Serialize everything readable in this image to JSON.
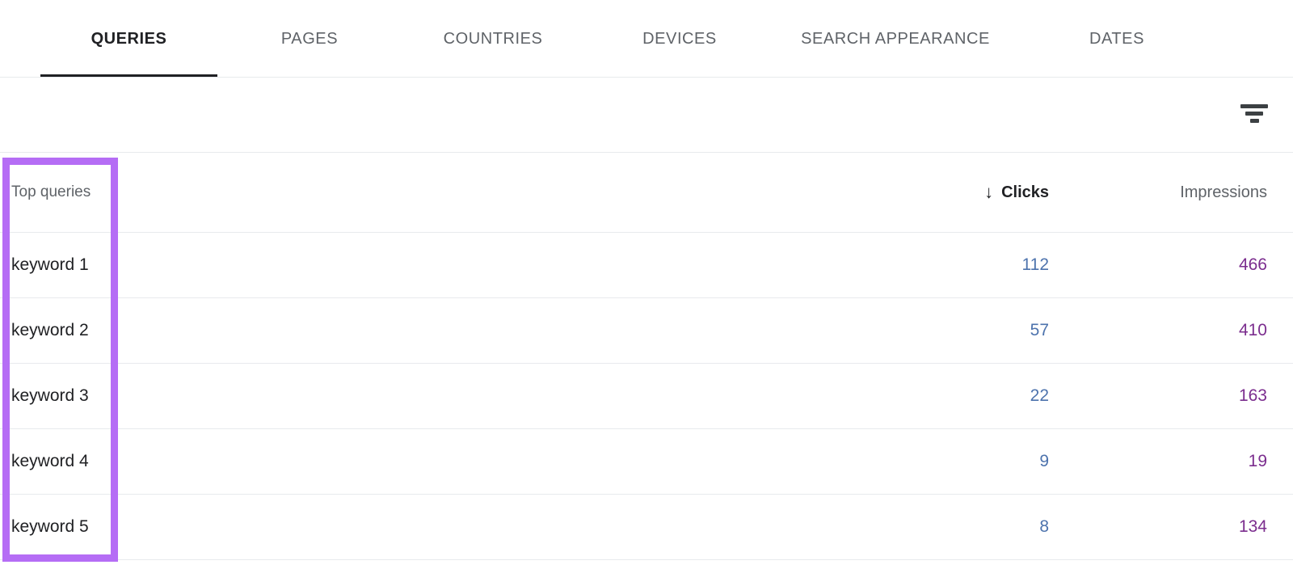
{
  "tabs": [
    {
      "label": "QUERIES",
      "active": true
    },
    {
      "label": "PAGES",
      "active": false
    },
    {
      "label": "COUNTRIES",
      "active": false
    },
    {
      "label": "DEVICES",
      "active": false
    },
    {
      "label": "SEARCH APPEARANCE",
      "active": false
    },
    {
      "label": "DATES",
      "active": false
    }
  ],
  "toolbar": {
    "filter_icon": "filter-icon"
  },
  "table": {
    "columns": {
      "query": "Top queries",
      "clicks": "Clicks",
      "impressions": "Impressions"
    },
    "sort": {
      "column": "Clicks",
      "direction": "descending",
      "arrow_glyph": "↓"
    },
    "rows": [
      {
        "query": "keyword 1",
        "clicks": "112",
        "impressions": "466"
      },
      {
        "query": "keyword 2",
        "clicks": "57",
        "impressions": "410"
      },
      {
        "query": "keyword 3",
        "clicks": "22",
        "impressions": "163"
      },
      {
        "query": "keyword 4",
        "clicks": "9",
        "impressions": "19"
      },
      {
        "query": "keyword 5",
        "clicks": "8",
        "impressions": "134"
      }
    ]
  },
  "annotation": {
    "highlight_color": "#b56df5",
    "target": "Top queries column"
  },
  "colors": {
    "clicks_value": "#4d73ad",
    "impressions_value": "#7b2d8e",
    "active_tab": "#202124",
    "inactive_tab": "#5f6368",
    "divider": "#e8eaed"
  }
}
